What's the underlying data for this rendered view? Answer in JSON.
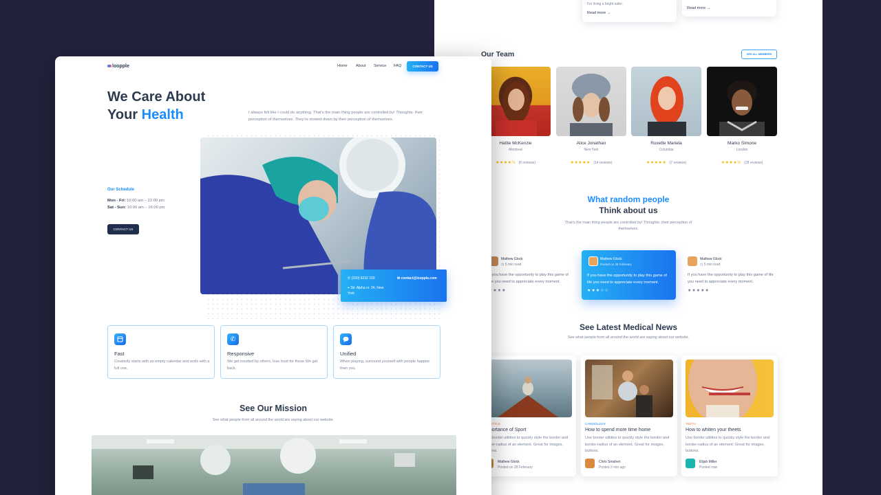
{
  "nav": {
    "logo": "loopple",
    "links": [
      "Home",
      "About",
      "Service",
      "FAQ"
    ],
    "contact_btn": "CONTACT US"
  },
  "hero": {
    "title_line1": "We Care About",
    "title_line2_a": "Your ",
    "title_line2_b": "Health",
    "description": "I always felt like I could do anything. That's the main thing people are controlled by! Thoughts- their perception of themselves. They're slowed down by their perception of themselves."
  },
  "schedule": {
    "title": "Our Schedule",
    "line1_label": "Mon - Fri:",
    "line1_value": " 10:00 am – 22:00 pm",
    "line2_label": "Sat - Sun:",
    "line2_value": " 10:00 am – 16:00 pm",
    "button": "CONTACT US"
  },
  "contact_box": {
    "phone": "(330) 0232 329",
    "email": "contact@loopple.com",
    "address": "Str. Alpha nr. 24, New York"
  },
  "features": [
    {
      "title": "Fast",
      "desc": "Creativity starts with an empty calendar and ends with a full one.",
      "icon": "calendar-icon"
    },
    {
      "title": "Responsive",
      "desc": "We get insulted by others, lose trust for those We get back.",
      "icon": "phone-icon"
    },
    {
      "title": "Unified",
      "desc": "When playing, surround yourself with people happier than you.",
      "icon": "chat-icon"
    }
  ],
  "mission": {
    "title": "See Our Mission",
    "subtitle": "See what people from all around the world are saying about our website."
  },
  "top_cards": {
    "card1_text": "For living a bright safer.",
    "read_more": "Read more"
  },
  "team": {
    "title": "Our Team",
    "see_all": "SEE ALL MEMBERS",
    "members": [
      {
        "name": "Hattie McKenzie",
        "city": "Montreal",
        "reviews": "(8 reviews)",
        "rating": 4.5
      },
      {
        "name": "Alice Jonathan",
        "city": "New York",
        "reviews": "(14 reviews)",
        "rating": 5
      },
      {
        "name": "Ruxette Mariela",
        "city": "Columbia",
        "reviews": "(7 reviews)",
        "rating": 5
      },
      {
        "name": "Marko Simone",
        "city": "London",
        "reviews": "(28 reviews)",
        "rating": 4.5
      }
    ]
  },
  "testimonials": {
    "title_a": "What random people",
    "title_b": "Think about us",
    "subtitle": "That's the main thing people are controlled by! Thoughts- their perception of themselves.",
    "items": [
      {
        "name": "Mathew Glock",
        "time": "5 min read",
        "quote": "If you have the opportunity to play this game of life you need to appreciate every moment."
      },
      {
        "name": "Mathew Glock",
        "time": "Posted on 28 February",
        "quote": "If you have the opportunity to play this game of life you need to appreciate every moment."
      },
      {
        "name": "Mathew Glock",
        "time": "5 min read",
        "quote": "If you have the opportunity to play this game of life you need to appreciate every moment."
      }
    ]
  },
  "news": {
    "title": "See Latest Medical News",
    "subtitle": "See what people from all around the world are saying about our website.",
    "items": [
      {
        "category": "LIFESTYLE",
        "title": "Importance of Sport",
        "desc": "Use border utilities to quickly style the border and border-radius of an element. Great for images, buttons.",
        "author": "Mathew Glock",
        "date": "Posted on 28 February"
      },
      {
        "category": "CARDIOLOGY",
        "title": "How to spend more time home",
        "desc": "Use border utilities to quickly style the border and border-radius of an element. Great for images, buttons.",
        "author": "Chris Smahen",
        "date": "Posted 2 min ago"
      },
      {
        "category": "TEETH",
        "title": "How to whiten your theets",
        "desc": "Use border utilities to quickly style the border and border-radius of an element. Great for images, buttons.",
        "author": "Elijah Miller",
        "date": "Posted now"
      }
    ]
  },
  "colors": {
    "accent": "#1a8cff",
    "navy": "#2d3a4f",
    "star": "#f4b400",
    "background": "#22223d"
  }
}
